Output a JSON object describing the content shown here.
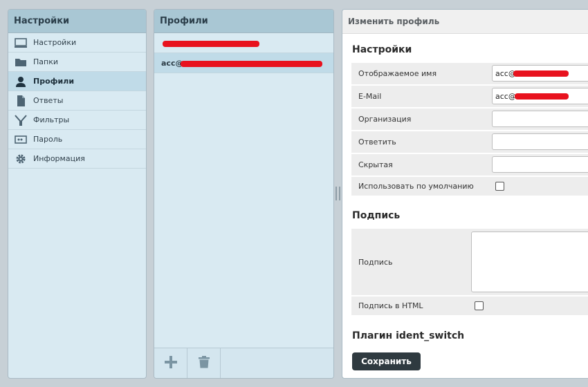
{
  "settings_panel": {
    "title": "Настройки",
    "items": [
      {
        "label": "Настройки",
        "icon": "computer-icon",
        "active": false
      },
      {
        "label": "Папки",
        "icon": "folder-icon",
        "active": false
      },
      {
        "label": "Профили",
        "icon": "user-icon",
        "active": true
      },
      {
        "label": "Ответы",
        "icon": "document-icon",
        "active": false
      },
      {
        "label": "Фильтры",
        "icon": "filter-icon",
        "active": false
      },
      {
        "label": "Пароль",
        "icon": "password-icon",
        "active": false
      },
      {
        "label": "Информация",
        "icon": "gear-icon",
        "active": false
      }
    ]
  },
  "profiles_panel": {
    "title": "Профили",
    "items": [
      {
        "label": "",
        "active": false
      },
      {
        "label": "acc@",
        "active": true
      }
    ]
  },
  "edit_panel": {
    "title": "Изменить профиль",
    "settings_section": {
      "title": "Настройки",
      "display_name_label": "Отображаемое имя",
      "display_name_value": "acc@",
      "email_label": "E-Mail",
      "email_value": "acc@",
      "organization_label": "Организация",
      "organization_value": "",
      "reply_to_label": "Ответить",
      "reply_to_value": "",
      "bcc_label": "Скрытая",
      "bcc_value": "",
      "default_label": "Использовать по умолчанию",
      "default_checked": false
    },
    "signature_section": {
      "title": "Подпись",
      "signature_label": "Подпись",
      "signature_value": "",
      "html_signature_label": "Подпись в HTML",
      "html_signature_checked": false
    },
    "plugin_section": {
      "title": "Плагин ident_switch"
    },
    "save_label": "Сохранить"
  },
  "colors": {
    "accent": "#a9c7d4",
    "sidebar_bg": "#d9eaf2",
    "active_item": "#c0dbe8",
    "redaction": "#e8121e",
    "save_button": "#2f3a40"
  }
}
